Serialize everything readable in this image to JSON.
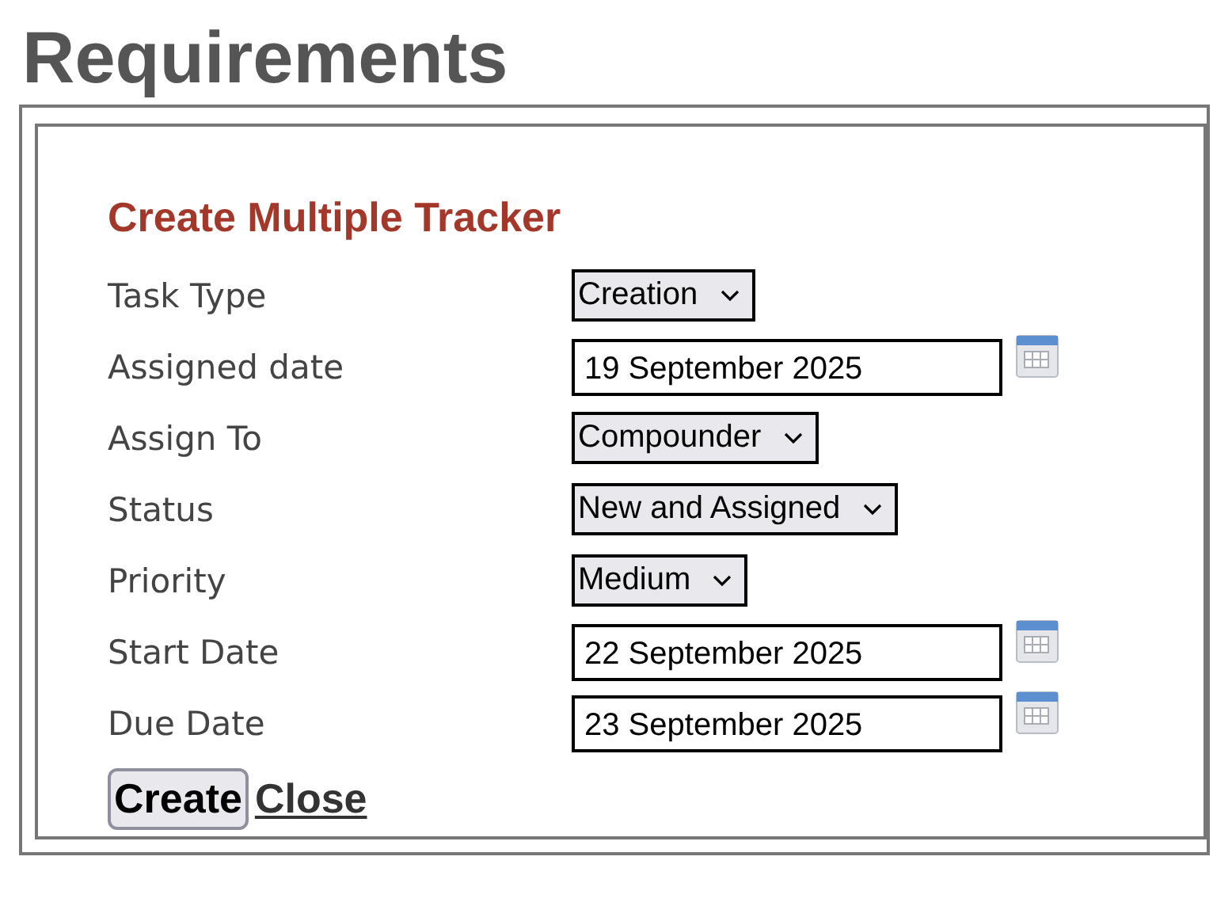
{
  "page_title": "Requirements",
  "form": {
    "title": "Create Multiple Tracker",
    "fields": [
      {
        "label": "Task Type",
        "kind": "select",
        "value": "Creation"
      },
      {
        "label": "Assigned date",
        "kind": "date",
        "value": "19 September 2025"
      },
      {
        "label": "Assign To",
        "kind": "select",
        "value": "Compounder"
      },
      {
        "label": "Status",
        "kind": "select",
        "value": "New and Assigned"
      },
      {
        "label": "Priority",
        "kind": "select",
        "value": "Medium"
      },
      {
        "label": "Start Date",
        "kind": "date",
        "value": "22 September 2025"
      },
      {
        "label": "Due Date",
        "kind": "date",
        "value": "23 September 2025"
      }
    ],
    "buttons": [
      {
        "label": "Create",
        "kind": "button"
      },
      {
        "label": "Close",
        "kind": "link"
      }
    ]
  }
}
